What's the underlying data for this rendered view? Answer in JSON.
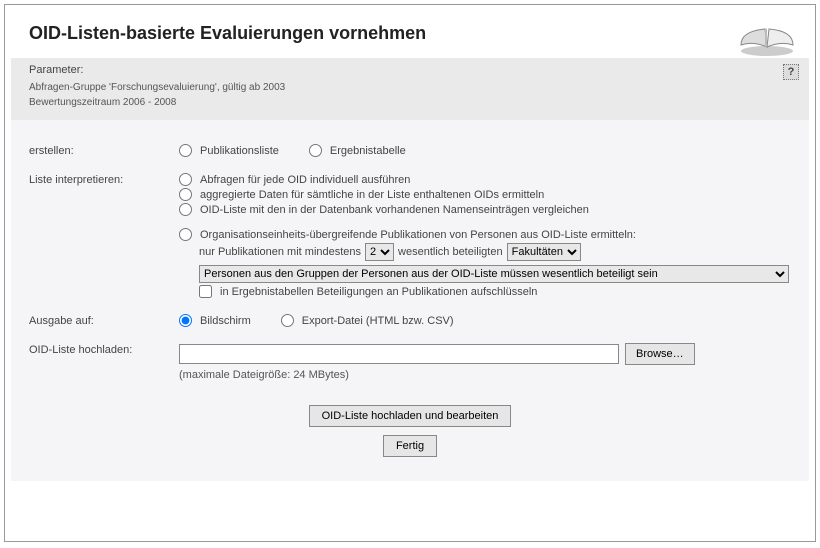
{
  "header": {
    "title": "OID-Listen-basierte Evaluierungen vornehmen"
  },
  "parameter": {
    "label": "Parameter:",
    "line1": "Abfragen-Gruppe 'Forschungsevaluierung', gültig ab 2003",
    "line2": "Bewertungszeitraum 2006 - 2008",
    "help_label": "?"
  },
  "form": {
    "create": {
      "label": "erstellen:",
      "opt_publist": "Publikationsliste",
      "opt_table": "Ergebnistabelle"
    },
    "interpret": {
      "label": "Liste interpretieren:",
      "opt_individual": "Abfragen für jede OID individuell ausführen",
      "opt_aggregate": "aggregierte Daten für sämtliche in der Liste enthaltenen OIDs ermitteln",
      "opt_compare": "OID-Liste mit den in der Datenbank vorhandenen Namenseinträgen vergleichen",
      "opt_orgcross": "Organisationseinheits-übergreifende Publikationen von Personen aus OID-Liste ermitteln:",
      "sub_prefix": "nur Publikationen mit mindestens",
      "sub_mid": "wesentlich beteiligten",
      "min_options": [
        "2"
      ],
      "unit_options": [
        "Fakultäten"
      ],
      "group_select_options": [
        "Personen aus den Gruppen der Personen aus der OID-Liste müssen wesentlich beteiligt sein"
      ],
      "checkbox_label": "in Ergebnistabellen Beteiligungen an Publikationen aufschlüsseln"
    },
    "output": {
      "label": "Ausgabe auf:",
      "opt_screen": "Bildschirm",
      "opt_export": "Export-Datei (HTML bzw. CSV)"
    },
    "upload": {
      "label": "OID-Liste hochladen:",
      "browse": "Browse…",
      "hint": "(maximale Dateigröße: 24 MBytes)"
    },
    "buttons": {
      "process": "OID-Liste hochladen und bearbeiten",
      "done": "Fertig"
    }
  }
}
